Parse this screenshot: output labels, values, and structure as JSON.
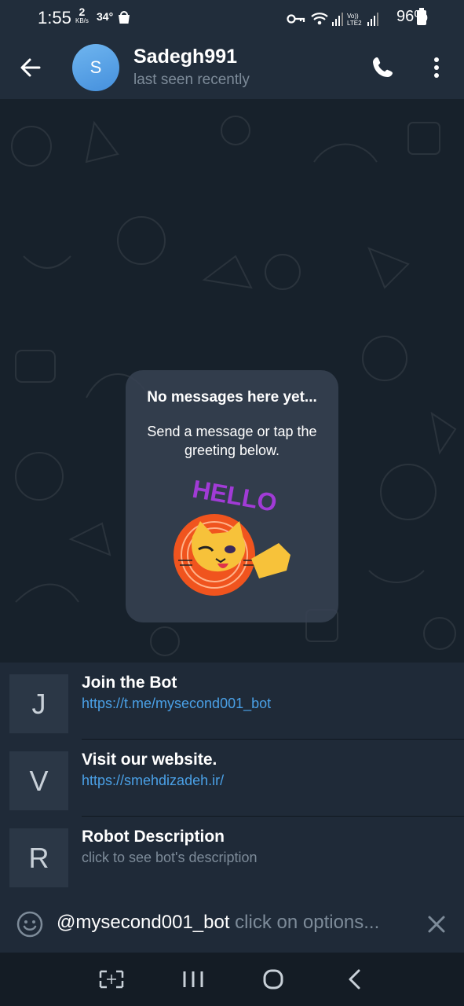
{
  "status_bar": {
    "time": "1:55",
    "speed_value": "2",
    "speed_unit": "KB/s",
    "temperature": "34°",
    "battery": "96%"
  },
  "header": {
    "avatar_letter": "S",
    "title": "Sadegh991",
    "subtitle": "last seen recently"
  },
  "empty_state": {
    "title": "No messages here yet...",
    "text": "Send a message or tap the greeting below.",
    "sticker_text": "HELLO"
  },
  "bot_options": [
    {
      "letter": "J",
      "title": "Join the Bot",
      "description": "https://t.me/mysecond001_bot"
    },
    {
      "letter": "V",
      "title": "Visit our website.",
      "description": "https://smehdizadeh.ir/"
    },
    {
      "letter": "R",
      "title": "Robot Description",
      "description": "click to see bot's description"
    }
  ],
  "input": {
    "value": "@mysecond001_bot",
    "placeholder": "click on options..."
  },
  "colors": {
    "header_bg": "#212d3b",
    "chat_bg": "#17212b",
    "link": "#4aa0e6",
    "muted": "#7d8b99"
  }
}
